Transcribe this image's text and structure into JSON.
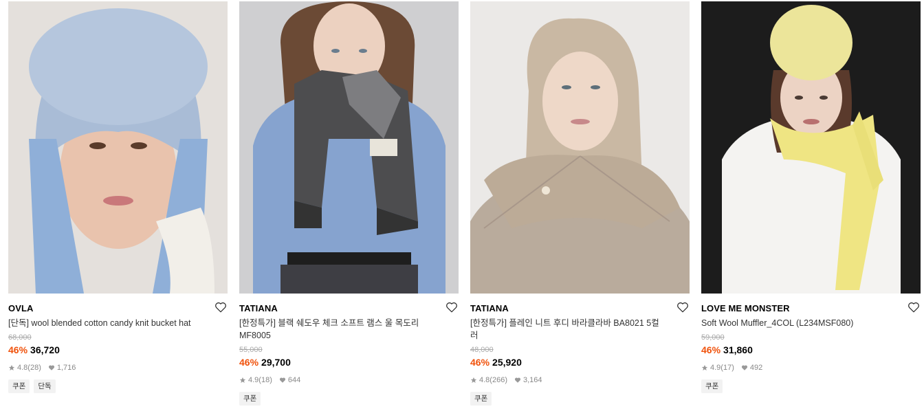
{
  "products": [
    {
      "image_alt": "model wearing light blue fuzzy bucket hat and blue gloves",
      "brand": "OVLA",
      "name": "[단독] wool blended cotton candy knit bucket hat",
      "original_price": "68,000",
      "discount": "46%",
      "price": "36,720",
      "rating": "4.8",
      "review_count": "(28)",
      "likes": "1,716",
      "tags": [
        "쿠폰",
        "단독"
      ]
    },
    {
      "image_alt": "model wearing black and grey check scarf with blue sweater",
      "brand": "TATIANA",
      "name": "[한정특가] 블랙 쉐도우 체크 소프트 램스 울 목도리 MF8005",
      "original_price": "55,000",
      "discount": "46%",
      "price": "29,700",
      "rating": "4.9",
      "review_count": "(18)",
      "likes": "644",
      "tags": [
        "쿠폰"
      ]
    },
    {
      "image_alt": "model wearing beige knit hoodie balaclava",
      "brand": "TATIANA",
      "name": "[한정특가] 플레인 니트 후디 바라클라바 BA8021 5컬러",
      "original_price": "48,000",
      "discount": "46%",
      "price": "25,920",
      "rating": "4.8",
      "review_count": "(266)",
      "likes": "3,164",
      "tags": [
        "쿠폰"
      ]
    },
    {
      "image_alt": "model wearing yellow knit beanie and yellow wool muffler",
      "brand": "LOVE ME MONSTER",
      "name": "Soft Wool Muffler_4COL (L234MSF080)",
      "original_price": "59,000",
      "discount": "46%",
      "price": "31,860",
      "rating": "4.9",
      "review_count": "(17)",
      "likes": "492",
      "tags": [
        "쿠폰"
      ]
    }
  ],
  "colors": {
    "discount": "#f0520c",
    "original_price": "#aaaaaa",
    "meta": "#888888",
    "tag_bg": "#f2f2f2"
  },
  "icons": {
    "wishlist": "heart-outline-icon",
    "rating": "star-icon",
    "likes": "heart-filled-icon"
  }
}
